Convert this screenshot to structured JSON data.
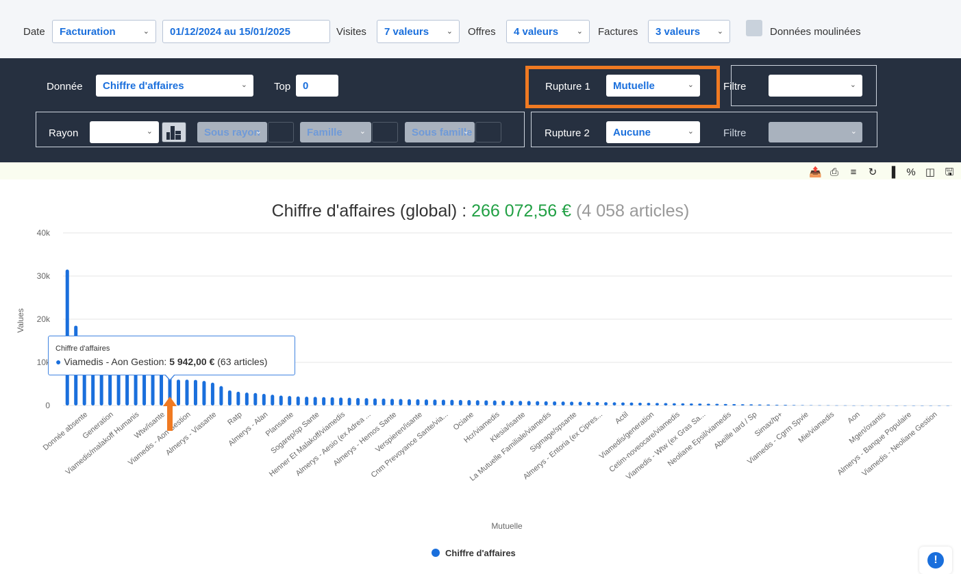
{
  "filters": {
    "date_label": "Date",
    "date_type": "Facturation",
    "date_range": "01/12/2024 au 15/01/2025",
    "visites_label": "Visites",
    "visites_value": "7 valeurs",
    "offres_label": "Offres",
    "offres_value": "4 valeurs",
    "factures_label": "Factures",
    "factures_value": "3 valeurs",
    "moulinees_label": "Données moulinées"
  },
  "panel": {
    "donnee_label": "Donnée",
    "donnee_value": "Chiffre d'affaires",
    "top_label": "Top",
    "top_value": "0",
    "rupture1_label": "Rupture 1",
    "rupture1_value": "Mutuelle",
    "filtre1_label": "Filtre",
    "rayon_label": "Rayon",
    "sous_rayon": "Sous rayon",
    "famille": "Famille",
    "sous_famille": "Sous famille",
    "rupture2_label": "Rupture 2",
    "rupture2_value": "Aucune",
    "filtre2_label": "Filtre"
  },
  "toolbar_icons": [
    "export-icon",
    "print-icon",
    "price-icon",
    "refresh-icon",
    "bar-chart-icon",
    "percent-icon",
    "columns-icon",
    "save-icon"
  ],
  "title": {
    "prefix": "Chiffre d'affaires (global) :",
    "total": "266 072,56 €",
    "articles": "(4 058 articles)"
  },
  "tooltip": {
    "series": "Chiffre d'affaires",
    "item": "Viamedis - Aon Gestion",
    "value": "5 942,00 €",
    "articles": "(63 articles)"
  },
  "legend": "Chiffre d'affaires",
  "colors": {
    "series": "#1a6fdc",
    "accent": "#f07a22",
    "panel": "#263040",
    "total": "#21a044"
  },
  "chart_data": {
    "type": "bar",
    "xlabel": "Mutuelle",
    "ylabel": "Values",
    "ylim": [
      0,
      40000
    ],
    "yticks": [
      "0",
      "10k",
      "20k",
      "30k",
      "40k"
    ],
    "grid": true,
    "legend_position": "bottom",
    "category_labels": [
      "Donnée absente",
      "Generation",
      "Viamedis/malakoff Humanis",
      "Wtw/isante",
      "Viamedis - Aon Gestion",
      "Almerys - Viasante",
      "Ratp",
      "Almerys - Alan",
      "Plansante",
      "Sogarep/sp Sante",
      "Henner Et Malakoff/viamedis",
      "Almerys - Aesio (ex Adrea ...",
      "Almerys - Hemos Sante",
      "Verspieren/isante",
      "Cnm Prevoyance Sante/via...",
      "Ociane",
      "Hcr/viamedis",
      "Klesia/isante",
      "La Mutuelle Familiale/viamedis",
      "Sigmage/spsante",
      "Almerys - Entoria (ex Cipres...",
      "Actil",
      "Viamedis/generation",
      "Cetim-noveocare/viamedis",
      "Viamedis - Wtw (ex Gras Sa...",
      "Neoliane Epsil/viamedis",
      "Abeille Iard / Sp",
      "Simax/tp+",
      "Viamedis - Cgrm Spvie",
      "Mie/viamedis",
      "Aon",
      "Mgen/oxantis",
      "Almerys - Banque Populaire",
      "Viamedis - Neoliane Gestion"
    ],
    "values": [
      31500,
      18500,
      13500,
      12000,
      11000,
      10000,
      9500,
      9000,
      8500,
      8000,
      7800,
      7500,
      7000,
      6000,
      6000,
      5942,
      5700,
      5300,
      4500,
      3500,
      3200,
      3000,
      2900,
      2700,
      2500,
      2300,
      2200,
      2100,
      2050,
      2000,
      1950,
      1900,
      1850,
      1800,
      1750,
      1700,
      1650,
      1600,
      1550,
      1500,
      1470,
      1440,
      1410,
      1380,
      1350,
      1320,
      1290,
      1260,
      1230,
      1200,
      1170,
      1140,
      1110,
      1080,
      1050,
      1020,
      990,
      960,
      930,
      900,
      870,
      840,
      810,
      780,
      750,
      720,
      690,
      660,
      630,
      600,
      570,
      540,
      510,
      480,
      450,
      420,
      390,
      360,
      330,
      300,
      270,
      240,
      210,
      180,
      150,
      120,
      100,
      80,
      60,
      50,
      40,
      30,
      20,
      15,
      10,
      8,
      6,
      5,
      4,
      3,
      2,
      2,
      1,
      1
    ]
  }
}
